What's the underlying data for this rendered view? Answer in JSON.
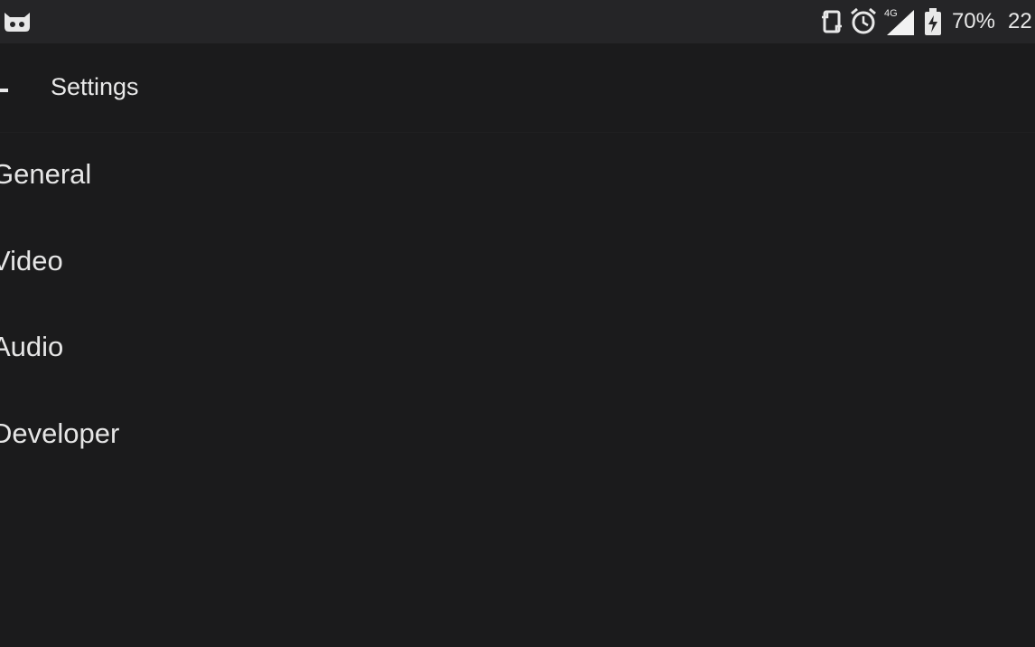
{
  "status_bar": {
    "left_icon": "cyanogen-mascot-icon",
    "icons": [
      "screen-rotation-icon",
      "alarm-clock-icon",
      "signal-4g-icon",
      "battery-charging-icon"
    ],
    "network_label": "4G",
    "battery_percent": "70%",
    "clock": "22"
  },
  "app_bar": {
    "back_icon": "back-arrow-icon",
    "title": "Settings"
  },
  "settings_list": {
    "items": [
      {
        "label": "General"
      },
      {
        "label": "Video"
      },
      {
        "label": "Audio"
      },
      {
        "label": "Developer"
      }
    ]
  },
  "colors": {
    "background": "#1b1b1c",
    "status_bar": "#252527",
    "text": "#e6e6e6"
  }
}
